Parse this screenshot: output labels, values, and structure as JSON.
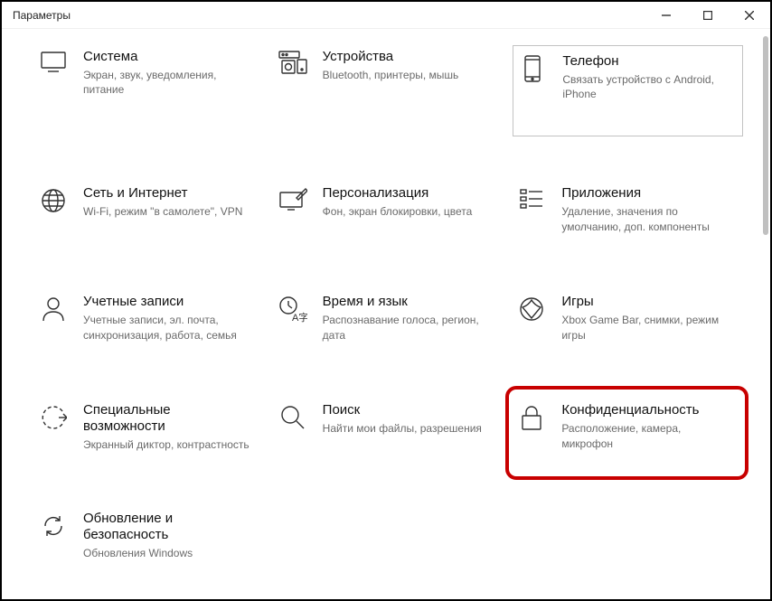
{
  "window": {
    "title": "Параметры"
  },
  "tiles": {
    "system": {
      "title": "Система",
      "desc": "Экран, звук, уведомления, питание"
    },
    "devices": {
      "title": "Устройства",
      "desc": "Bluetooth, принтеры, мышь"
    },
    "phone": {
      "title": "Телефон",
      "desc": "Связать устройство с Android, iPhone"
    },
    "network": {
      "title": "Сеть и Интернет",
      "desc": "Wi-Fi, режим \"в самолете\", VPN"
    },
    "personal": {
      "title": "Персонализация",
      "desc": "Фон, экран блокировки, цвета"
    },
    "apps": {
      "title": "Приложения",
      "desc": "Удаление, значения по умолчанию, доп. компоненты"
    },
    "accounts": {
      "title": "Учетные записи",
      "desc": "Учетные записи, эл. почта, синхронизация, работа, семья"
    },
    "time": {
      "title": "Время и язык",
      "desc": "Распознавание голоса, регион, дата"
    },
    "gaming": {
      "title": "Игры",
      "desc": "Xbox Game Bar, снимки, режим игры"
    },
    "ease": {
      "title": "Специальные возможности",
      "desc": "Экранный диктор, контрастность"
    },
    "search": {
      "title": "Поиск",
      "desc": "Найти мои файлы, разрешения"
    },
    "privacy": {
      "title": "Конфиденциальность",
      "desc": "Расположение, камера, микрофон"
    },
    "update": {
      "title": "Обновление и безопасность",
      "desc": "Обновления Windows"
    }
  }
}
